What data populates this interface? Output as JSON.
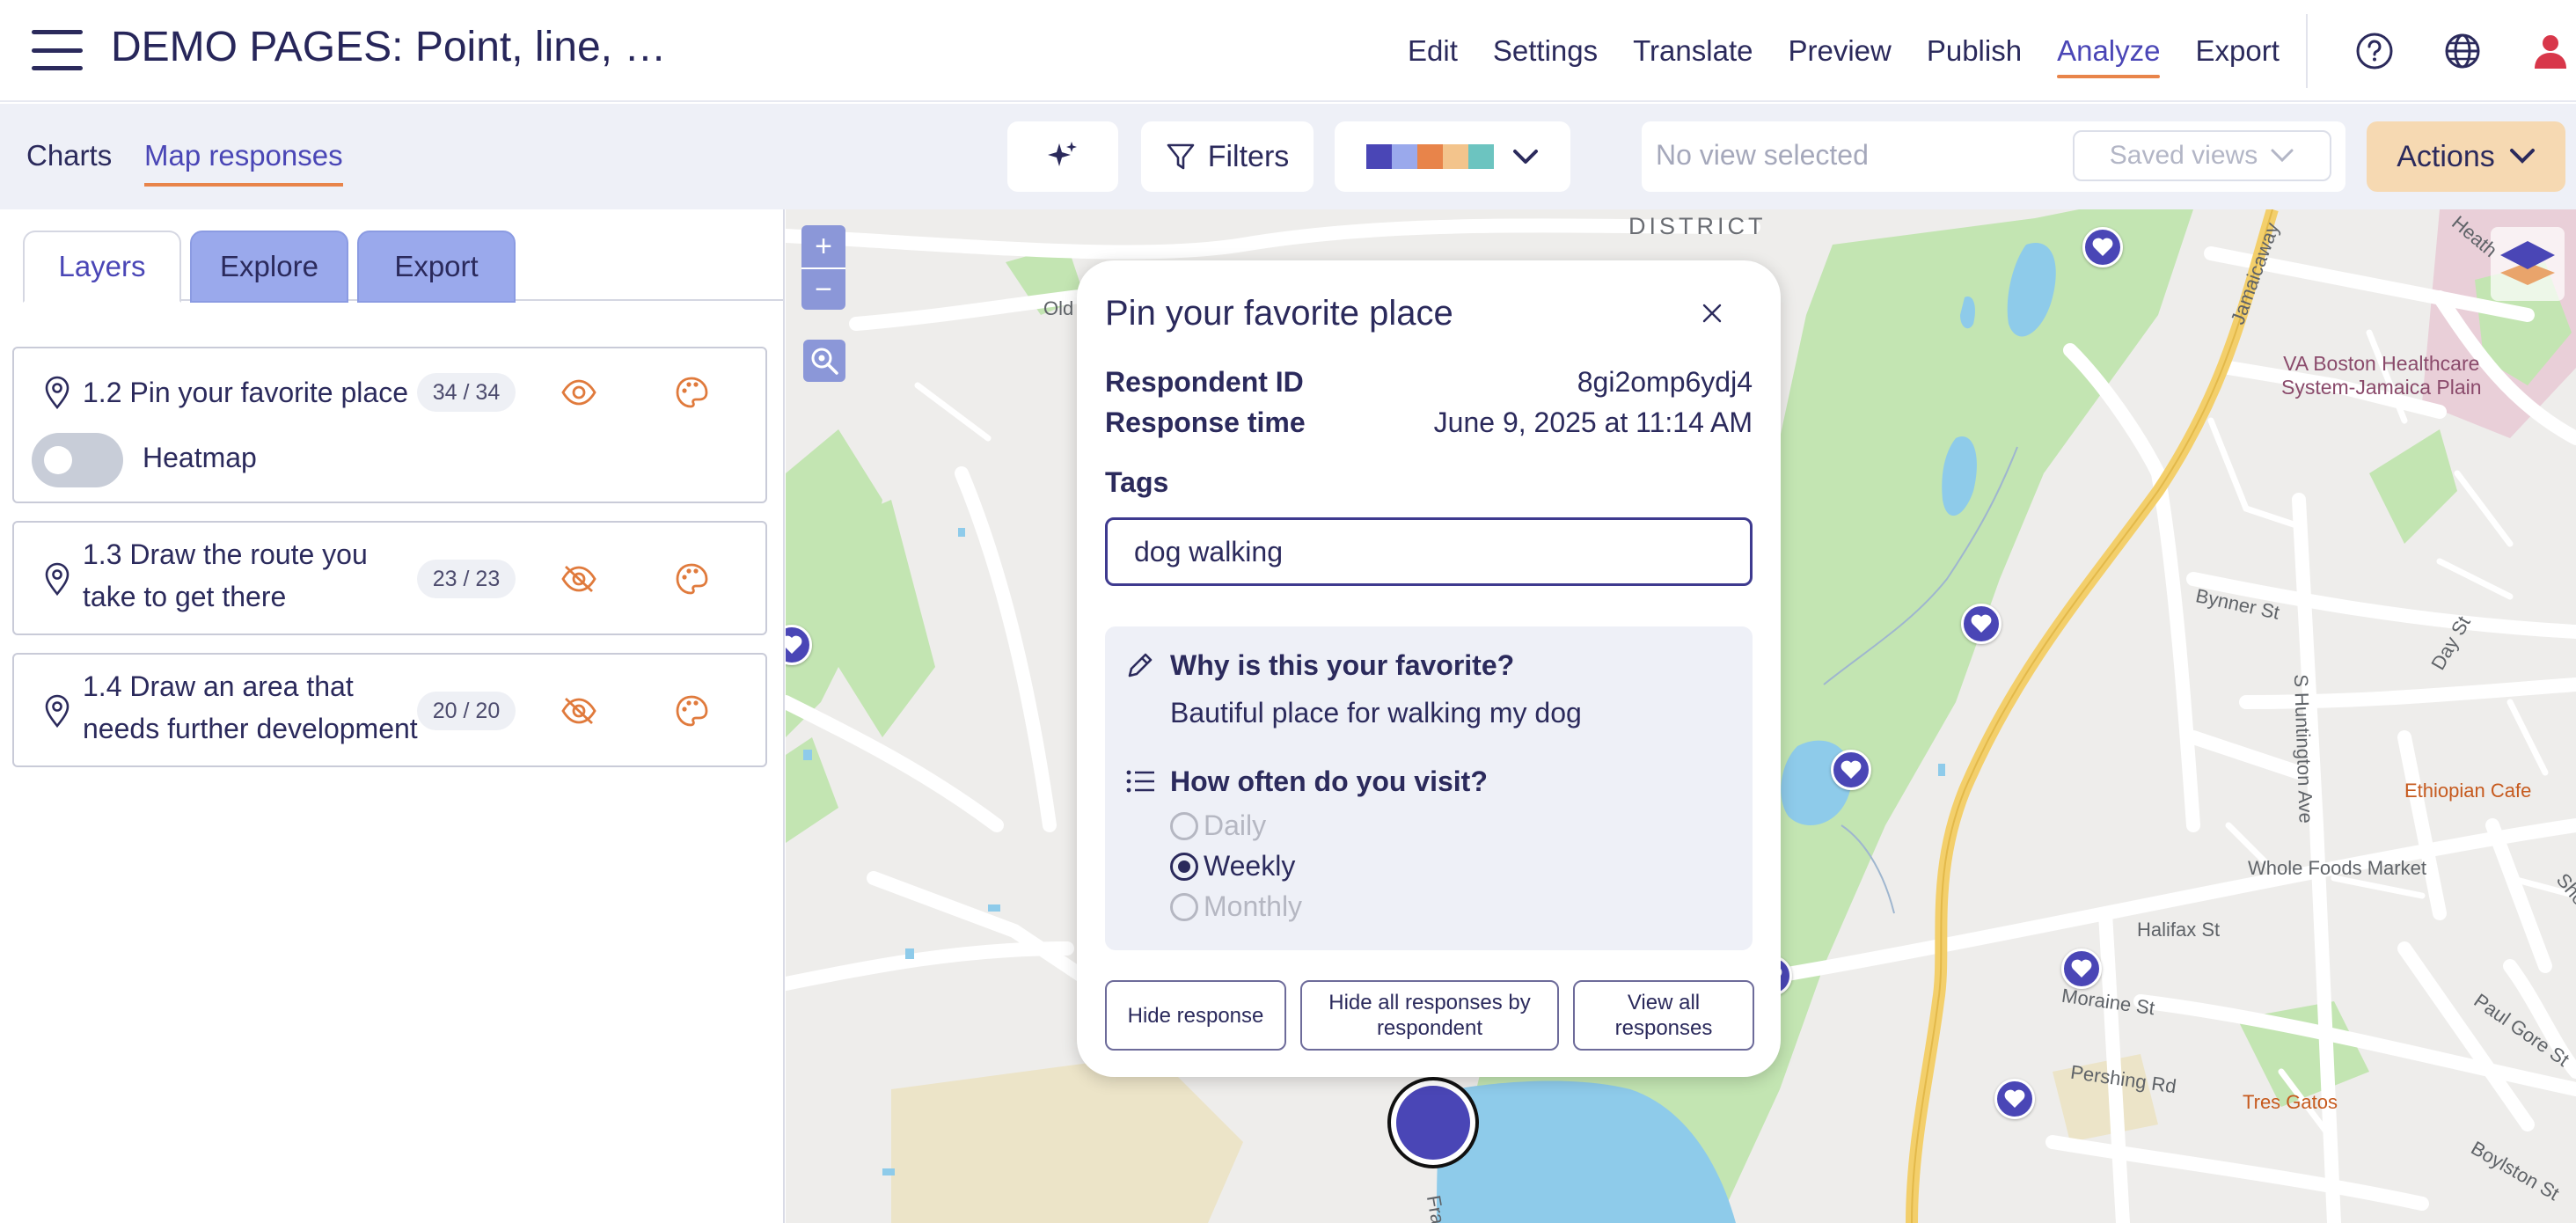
{
  "app": {
    "title": "DEMO PAGES: Point, line, …"
  },
  "topnav": {
    "items": [
      {
        "label": "Edit",
        "active": false
      },
      {
        "label": "Settings",
        "active": false
      },
      {
        "label": "Translate",
        "active": false
      },
      {
        "label": "Preview",
        "active": false
      },
      {
        "label": "Publish",
        "active": false
      },
      {
        "label": "Analyze",
        "active": true
      },
      {
        "label": "Export",
        "active": false
      }
    ],
    "icons": [
      "help-icon",
      "globe-icon",
      "user-icon"
    ]
  },
  "subbar": {
    "tabs": [
      {
        "label": "Charts",
        "active": false
      },
      {
        "label": "Map responses",
        "active": true
      }
    ],
    "filters_label": "Filters",
    "palette_colors": [
      "#4a46b6",
      "#9aa9ec",
      "#e8844a",
      "#f3c48c",
      "#6cc4c0"
    ],
    "views_placeholder": "No view selected",
    "saved_views_label": "Saved views",
    "actions_label": "Actions"
  },
  "left_panel": {
    "tabs": [
      "Layers",
      "Explore",
      "Export"
    ],
    "active_tab": "Layers",
    "layers": [
      {
        "title_lines": [
          "1.2 Pin your favorite place"
        ],
        "count": "34 / 34",
        "visible": true,
        "heatmap_label": "Heatmap",
        "heatmap_on": false
      },
      {
        "title_lines": [
          "1.3 Draw the route you",
          "take to get there"
        ],
        "count": "23 / 23",
        "visible": false
      },
      {
        "title_lines": [
          "1.4 Draw an area that",
          "needs further development"
        ],
        "count": "20 / 20",
        "visible": false
      }
    ]
  },
  "map": {
    "zoom_in": "+",
    "zoom_out": "−",
    "labels": {
      "district": "DISTRICT",
      "old": "Old",
      "jamaicaway": "Jamaicaway",
      "heath": "Heath",
      "va_line1": "VA Boston Healthcare",
      "va_line2": "System-Jamaica Plain",
      "bynner": "Bynner St",
      "day": "Day St",
      "huntington": "S Huntington Ave",
      "ethiopian": "Ethiopian Cafe",
      "whole_foods": "Whole Foods Market",
      "halifax": "Halifax St",
      "moraine": "Moraine St",
      "paul_gore": "Paul Gore St",
      "pershing": "Pershing Rd",
      "tres_gatos": "Tres Gatos",
      "boylston": "Boylston St",
      "she": "She",
      "fra": "Fra"
    },
    "colors": {
      "land": "#eeedeb",
      "park": "#c3e5b2",
      "water": "#8ecbea",
      "road": "#ffffff",
      "highway": "#f3cf6b",
      "pin": "#4a46b6"
    }
  },
  "popup": {
    "title": "Pin your favorite place",
    "respondent_id_label": "Respondent ID",
    "respondent_id": "8gi2omp6ydj4",
    "response_time_label": "Response time",
    "response_time": "June 9, 2025 at 11:14 AM",
    "tags_label": "Tags",
    "tags_value": "dog walking",
    "q1": {
      "title": "Why is this your favorite?",
      "answer": "Bautiful place for walking my dog"
    },
    "q2": {
      "title": "How often do you visit?",
      "options": [
        {
          "label": "Daily",
          "selected": false
        },
        {
          "label": "Weekly",
          "selected": true
        },
        {
          "label": "Monthly",
          "selected": false
        }
      ]
    },
    "buttons": {
      "hide_response": "Hide response",
      "hide_all_line1": "Hide all responses by",
      "hide_all_line2": "respondent",
      "view_all_line1": "View all",
      "view_all_line2": "responses"
    }
  }
}
